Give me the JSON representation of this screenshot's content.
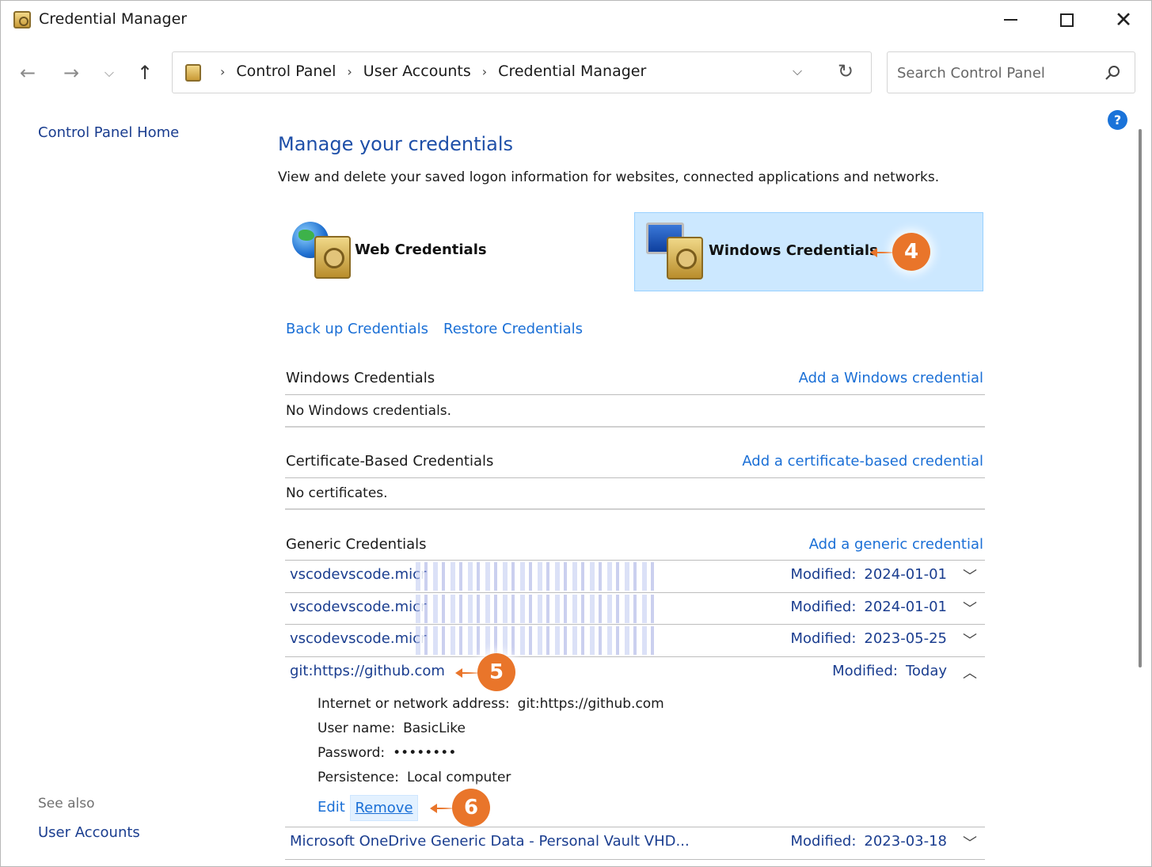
{
  "window": {
    "title": "Credential Manager",
    "minimize_label": "—",
    "maximize_label": "",
    "close_label": "✕"
  },
  "navigation": {
    "breadcrumbs": [
      "Control Panel",
      "User Accounts",
      "Credential Manager"
    ],
    "search_placeholder": "Search Control Panel"
  },
  "left_nav": {
    "home": "Control Panel Home",
    "see_also_label": "See also",
    "see_also_links": [
      "User Accounts"
    ]
  },
  "main": {
    "heading": "Manage your credentials",
    "description": "View and delete your saved logon information for websites, connected applications and networks.",
    "tiles": {
      "web": "Web Credentials",
      "windows": "Windows Credentials",
      "selected": "windows"
    },
    "backup_link": "Back up Credentials",
    "restore_link": "Restore Credentials",
    "sections": {
      "windows": {
        "title": "Windows Credentials",
        "add": "Add a Windows credential",
        "empty": "No Windows credentials."
      },
      "certificate": {
        "title": "Certificate-Based Credentials",
        "add": "Add a certificate-based credential",
        "empty": "No certificates."
      },
      "generic": {
        "title": "Generic Credentials",
        "add": "Add a generic credential"
      }
    },
    "generic_items": [
      {
        "name": "vscodevscode.micr",
        "modified_label": "Modified:",
        "modified": "2024-01-01",
        "expanded": false,
        "redacted": true
      },
      {
        "name": "vscodevscode.micr",
        "modified_label": "Modified:",
        "modified": "2024-01-01",
        "expanded": false,
        "redacted": true
      },
      {
        "name": "vscodevscode.micr",
        "modified_label": "Modified:",
        "modified": "2023-05-25",
        "expanded": false,
        "redacted": true
      },
      {
        "name": "git:https://github.com",
        "modified_label": "Modified:",
        "modified": "Today",
        "expanded": true,
        "redacted": false
      },
      {
        "name": "Microsoft OneDrive Generic Data - Personal Vault VHD...",
        "modified_label": "Modified:",
        "modified": "2023-03-18",
        "expanded": false,
        "redacted": false
      }
    ],
    "expanded_details": {
      "address_label": "Internet or network address:",
      "address": "git:https://github.com",
      "username_label": "User name:",
      "username": "BasicLike",
      "password_label": "Password:",
      "password": "••••••••",
      "persistence_label": "Persistence:",
      "persistence": "Local computer",
      "edit": "Edit",
      "remove": "Remove"
    }
  },
  "callouts": [
    "4",
    "5",
    "6"
  ],
  "colors": {
    "accent_link": "#1a6fd6",
    "heading_blue": "#1e4fa8",
    "callout_orange": "#e9752a",
    "tile_selected_bg": "#cce8ff"
  }
}
